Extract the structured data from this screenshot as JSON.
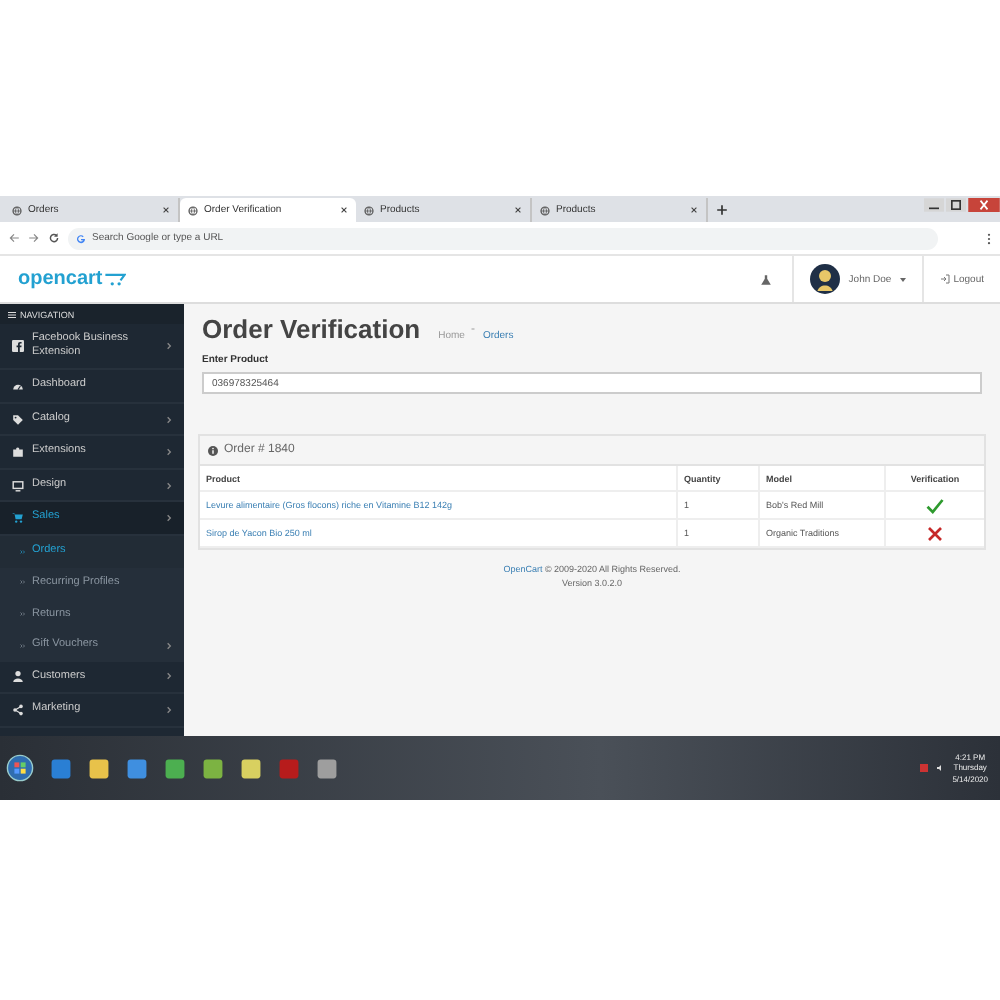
{
  "browser": {
    "tabs": [
      {
        "title": "Orders",
        "selected": false
      },
      {
        "title": "Order Verification",
        "selected": true
      },
      {
        "title": "Products",
        "selected": false
      },
      {
        "title": "Products",
        "selected": false
      }
    ],
    "address_placeholder": "Search Google or type a URL"
  },
  "header": {
    "logo": "opencart",
    "user": "John Doe",
    "logout": "Logout"
  },
  "sidebar": {
    "heading": "NAVIGATION",
    "items": [
      {
        "label": "Facebook Business Extension",
        "has_submenu": true,
        "selected": false
      },
      {
        "label": "Dashboard",
        "has_submenu": false,
        "selected": false
      },
      {
        "label": "Catalog",
        "has_submenu": true,
        "selected": false
      },
      {
        "label": "Extensions",
        "has_submenu": true,
        "selected": false
      },
      {
        "label": "Design",
        "has_submenu": true,
        "selected": false
      },
      {
        "label": "Sales",
        "has_submenu": true,
        "selected": true,
        "children": [
          {
            "label": "Orders",
            "has_submenu": false,
            "selected": true
          },
          {
            "label": "Recurring Profiles",
            "has_submenu": false,
            "selected": false
          },
          {
            "label": "Returns",
            "has_submenu": false,
            "selected": false
          },
          {
            "label": "Gift Vouchers",
            "has_submenu": true,
            "selected": false
          }
        ]
      },
      {
        "label": "Customers",
        "has_submenu": true,
        "selected": false
      },
      {
        "label": "Marketing",
        "has_submenu": true,
        "selected": false
      }
    ]
  },
  "page": {
    "title": "Order Verification",
    "breadcrumbs": [
      "Home",
      "Orders"
    ],
    "field": {
      "label": "Enter Product",
      "value": "036978325464"
    },
    "panel": {
      "title": "Order # 1840",
      "table": {
        "columns": [
          "Product",
          "Quantity",
          "Model",
          "Verification"
        ],
        "rows": [
          {
            "product": "Levure alimentaire (Gros flocons) riche en Vitamine B12 142g",
            "quantity": "1",
            "model": "Bob's Red Mill",
            "verified": true
          },
          {
            "product": "Sirop de Yacon Bio 250 ml",
            "quantity": "1",
            "model": "Organic Traditions",
            "verified": false
          }
        ]
      }
    }
  },
  "footer": {
    "link": "OpenCart",
    "text": " © 2009-2020 All Rights Reserved.",
    "version": "Version 3.0.2.0"
  },
  "taskbar": {
    "time": "4:21 PM",
    "day": "Thursday",
    "date": "5/14/2020"
  }
}
